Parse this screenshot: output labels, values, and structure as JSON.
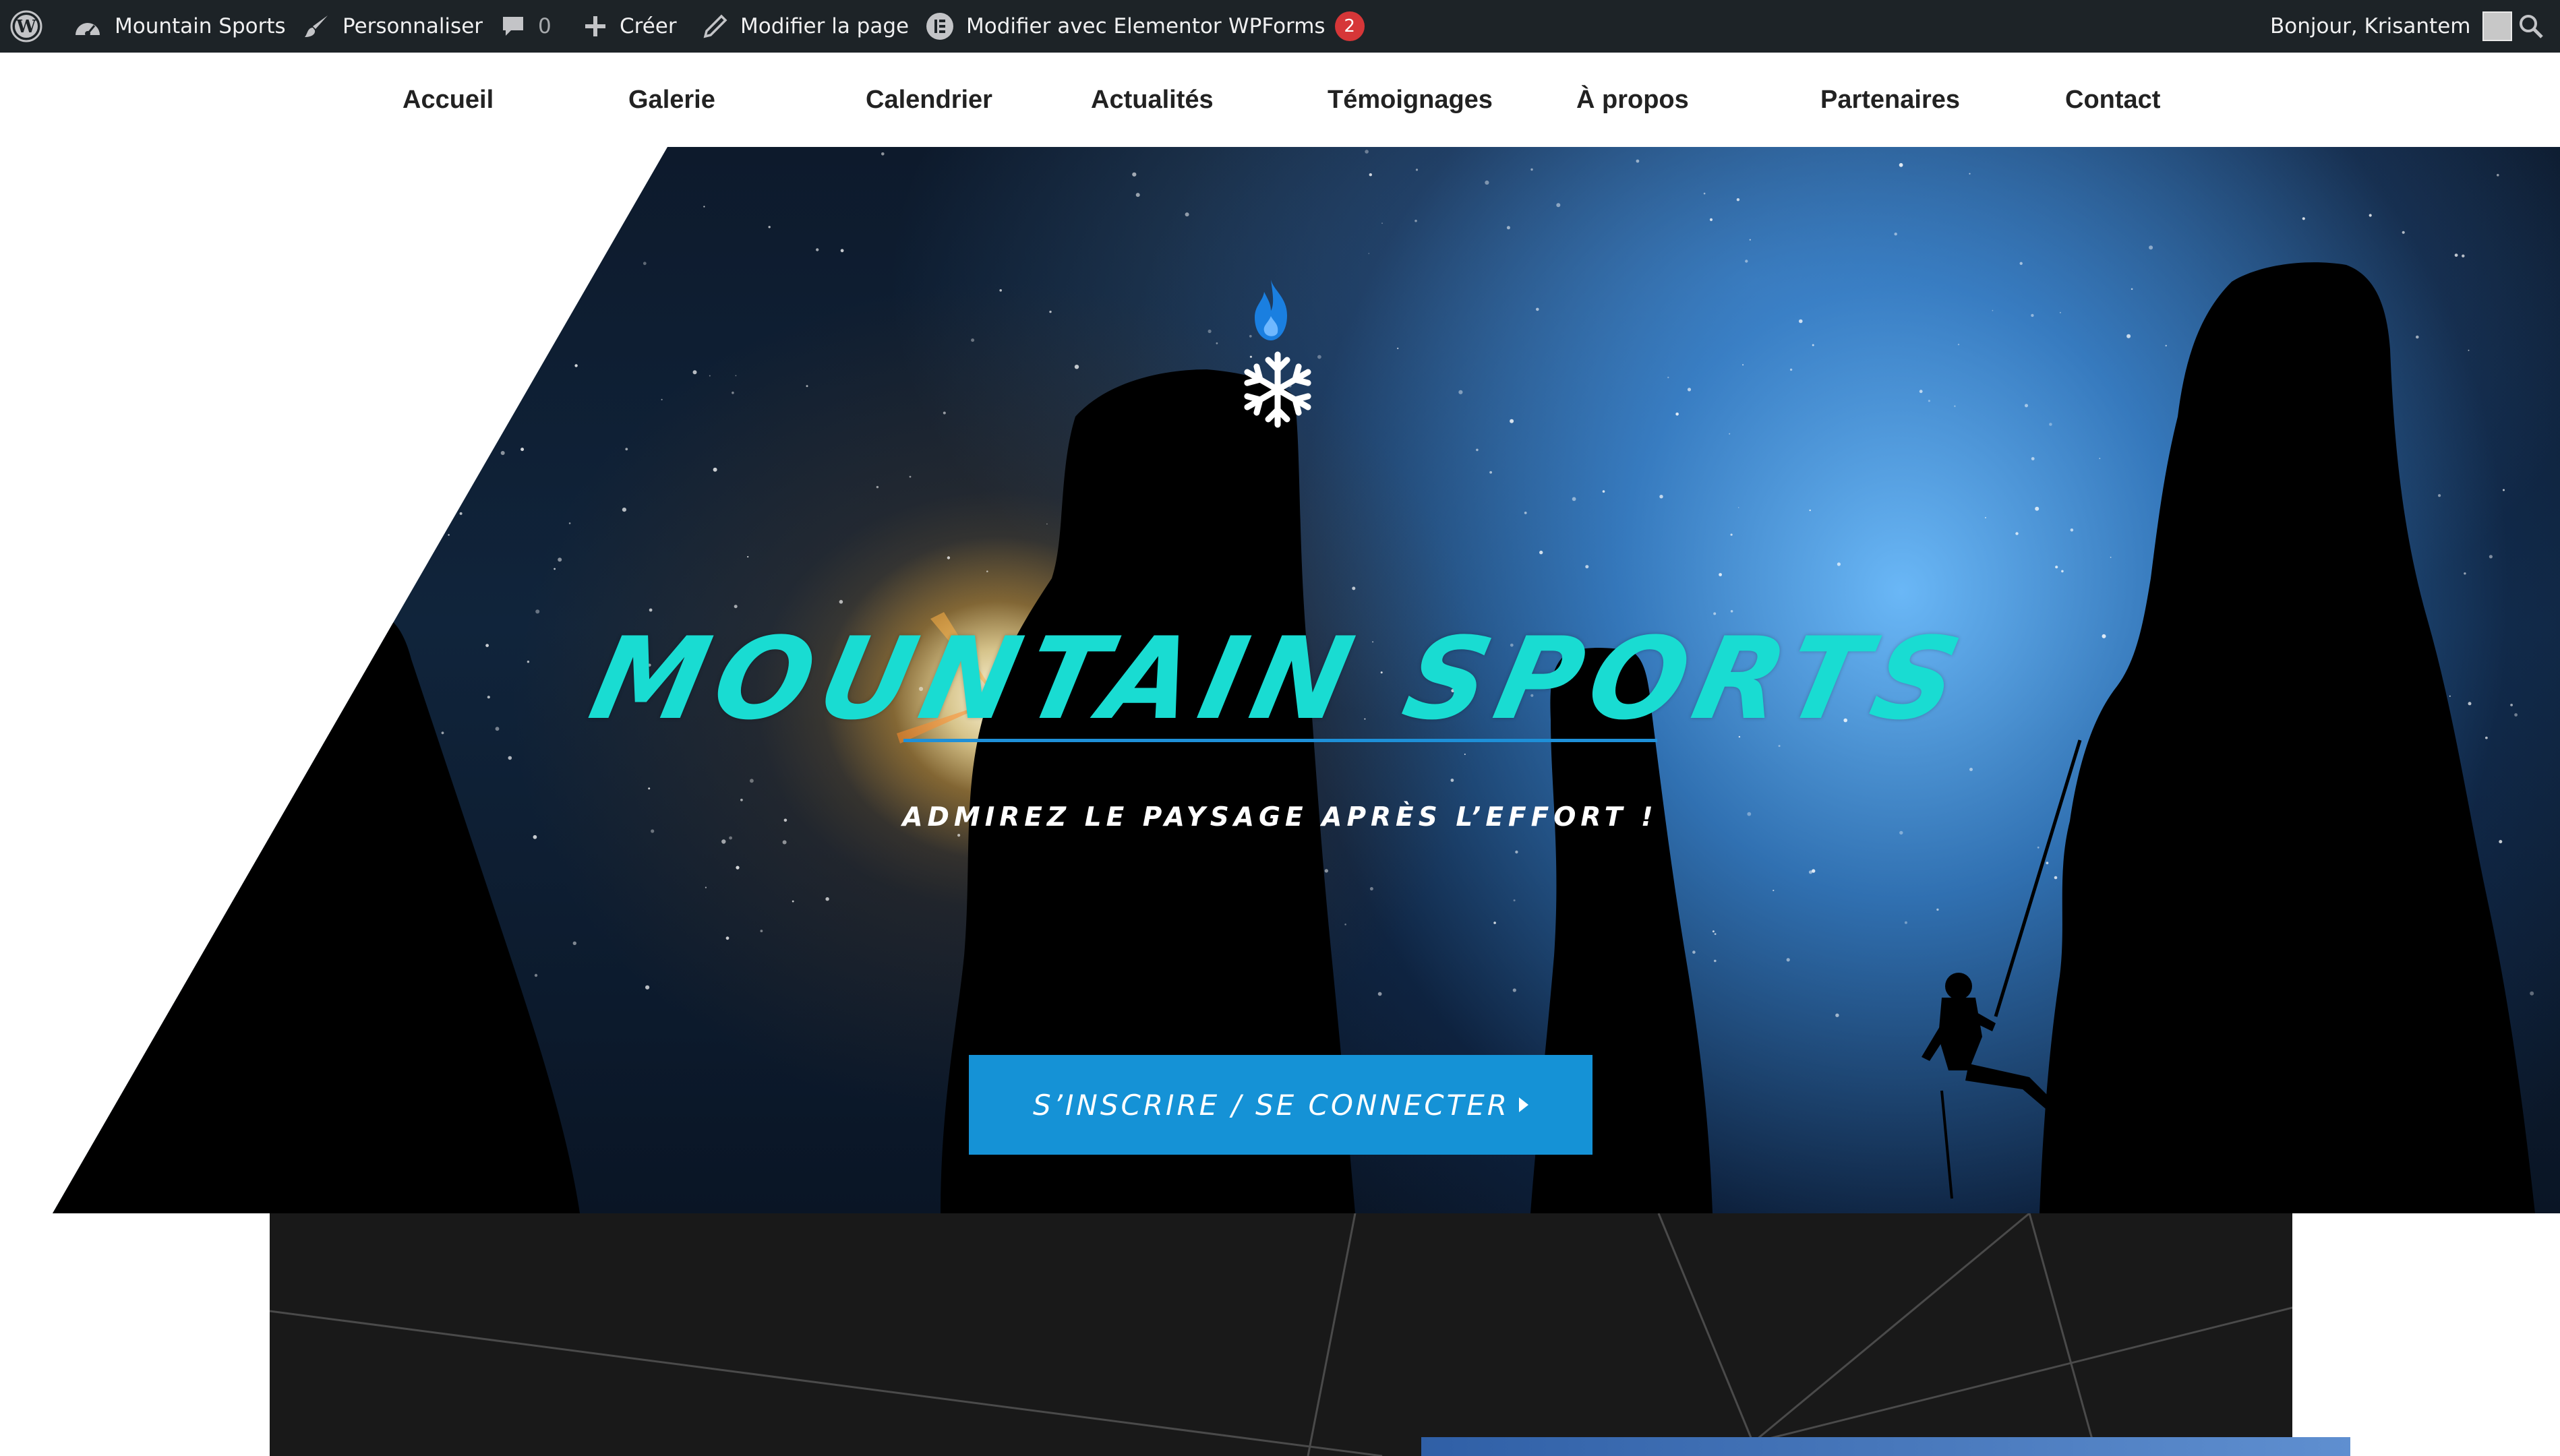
{
  "admin_bar": {
    "wp_logo_icon": "wordpress-logo-icon",
    "site_name": "Mountain Sports",
    "customize": "Personnaliser",
    "comments_count": "0",
    "new": "Créer",
    "edit_page": "Modifier la page",
    "edit_elementor": "Modifier avec Elementor",
    "wpforms": "WPForms",
    "wpforms_badge": "2",
    "greeting": "Bonjour, Krisantem"
  },
  "nav": {
    "items": [
      {
        "label": "Accueil"
      },
      {
        "label": "Galerie"
      },
      {
        "label": "Calendrier"
      },
      {
        "label": "Actualités"
      },
      {
        "label": "Témoignages"
      },
      {
        "label": "À propos"
      },
      {
        "label": "Partenaires"
      },
      {
        "label": "Contact"
      }
    ]
  },
  "hero": {
    "logo_icons": [
      "flame-icon",
      "snowflake-icon"
    ],
    "title": "MOUNTAIN SPORTS",
    "subtitle": "ADMIREZ LE PAYSAGE APRÈS L’EFFORT !",
    "cta_label": "S’INSCRIRE / SE CONNECTER"
  },
  "colors": {
    "admin_bar_bg": "#1d2327",
    "title_cyan": "#19dcd2",
    "accent_blue": "#1592d6",
    "underline_blue": "#1e90d8",
    "badge_red": "#d63638",
    "lower_section_bg": "#191919"
  }
}
